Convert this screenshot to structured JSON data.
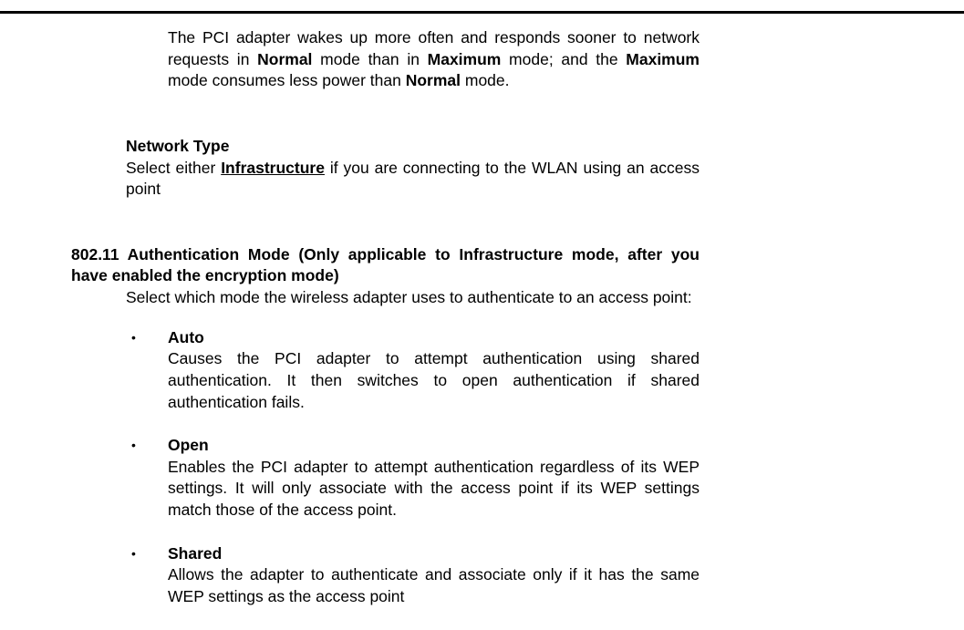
{
  "p1_a": "The PCI adapter wakes up more often and responds sooner to network requests in ",
  "p1_b": "Normal",
  "p1_c": " mode than in ",
  "p1_d": "Maximum",
  "p1_e": " mode; and the ",
  "p1_f": "Maximum",
  "p1_g": " mode consumes less power than ",
  "p1_h": "Normal",
  "p1_i": " mode.",
  "net_heading": "Network Type",
  "net_a": "Select either ",
  "net_b": "Infrastructure",
  "net_c": " if you are connecting to the WLAN using an access point",
  "auth_heading": "802.11 Authentication Mode (Only applicable to Infrastructure mode, after you have enabled the encryption mode)",
  "auth_body": "Select which mode the wireless adapter uses to authenticate to an access point:",
  "auto_label": "Auto",
  "auto_body": "Causes the PCI adapter to attempt authentication using shared authentication. It then switches to open authentication if shared authentication fails.",
  "open_label": "Open",
  "open_body": "Enables the PCI adapter to attempt authentication regardless of its WEP settings. It will only associate with the access point if its WEP settings match those of the access point.",
  "shared_label": "Shared",
  "shared_body": "Allows the adapter to authenticate and associate only if it has the same WEP settings as the access point"
}
